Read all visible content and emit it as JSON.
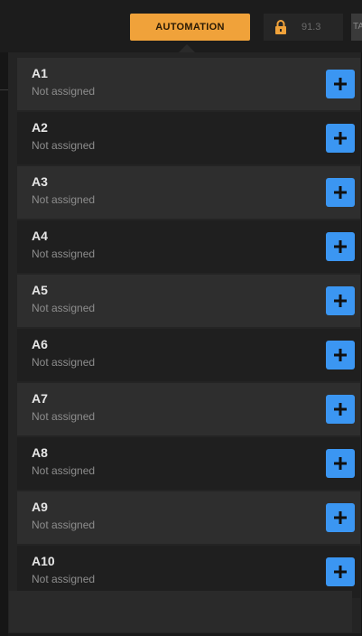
{
  "topbar": {
    "automation_label": "AUTOMATION",
    "tempo": "91.3",
    "tab_label": "TA",
    "lock_icon": "lock-icon",
    "accent_color": "#f0a23a"
  },
  "list": {
    "add_icon": "plus-icon",
    "add_color": "#3b96f2",
    "items": [
      {
        "title": "A1",
        "subtitle": "Not assigned"
      },
      {
        "title": "A2",
        "subtitle": "Not assigned"
      },
      {
        "title": "A3",
        "subtitle": "Not assigned"
      },
      {
        "title": "A4",
        "subtitle": "Not assigned"
      },
      {
        "title": "A5",
        "subtitle": "Not assigned"
      },
      {
        "title": "A6",
        "subtitle": "Not assigned"
      },
      {
        "title": "A7",
        "subtitle": "Not assigned"
      },
      {
        "title": "A8",
        "subtitle": "Not assigned"
      },
      {
        "title": "A9",
        "subtitle": "Not assigned"
      },
      {
        "title": "A10",
        "subtitle": "Not assigned"
      }
    ]
  }
}
